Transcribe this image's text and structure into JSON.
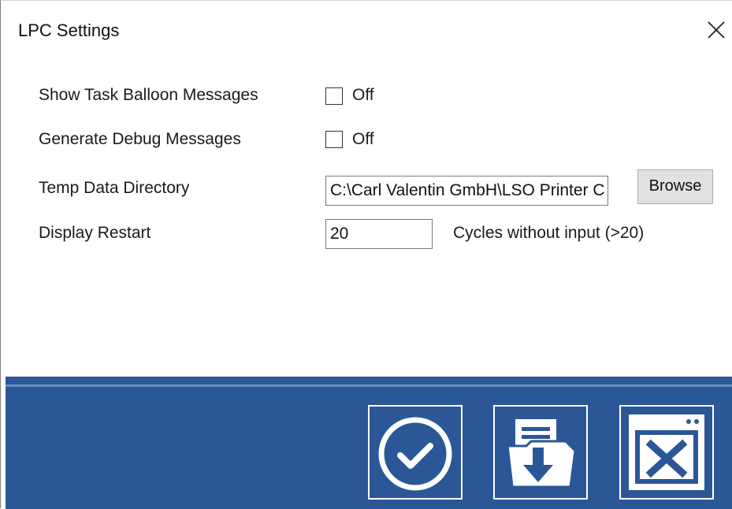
{
  "window": {
    "title": "LPC Settings",
    "close_icon": "close-icon"
  },
  "settings": {
    "show_task_balloon": {
      "label": "Show Task Balloon Messages",
      "checked": false,
      "state_text": "Off"
    },
    "generate_debug": {
      "label": "Generate Debug Messages",
      "checked": false,
      "state_text": "Off"
    },
    "temp_data_directory": {
      "label": "Temp Data Directory",
      "value": "C:\\Carl Valentin GmbH\\LSO Printer C",
      "browse_label": "Browse"
    },
    "display_restart": {
      "label": "Display Restart",
      "value": "20",
      "suffix": "Cycles without input (>20)"
    }
  },
  "footer": {
    "background": "#2b5797",
    "buttons": [
      {
        "icon": "checkmark-circle-icon"
      },
      {
        "icon": "save-document-icon"
      },
      {
        "icon": "close-window-icon"
      }
    ]
  }
}
